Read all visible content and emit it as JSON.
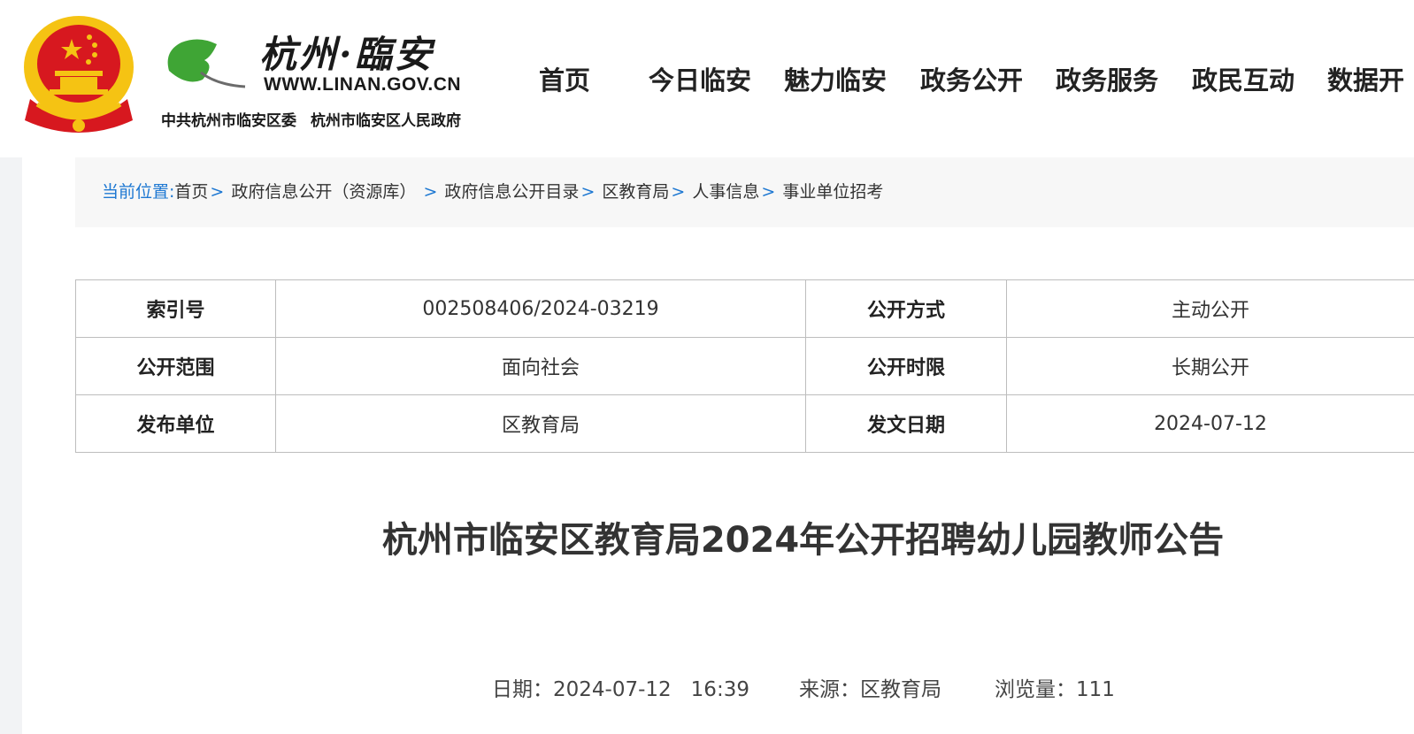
{
  "header": {
    "logo_calligraphy": "杭州·臨安",
    "site_url": "WWW.LINAN.GOV.CN",
    "org_party": "中共杭州市临安区委",
    "org_government": "杭州市临安区人民政府",
    "emblem_icon": "national-emblem-icon",
    "logo_icon": "ginkgo-leaf-icon"
  },
  "nav": {
    "items": [
      {
        "label": "首页"
      },
      {
        "label": "今日临安"
      },
      {
        "label": "魅力临安"
      },
      {
        "label": "政务公开"
      },
      {
        "label": "政务服务"
      },
      {
        "label": "政民互动"
      },
      {
        "label": "数据开"
      }
    ]
  },
  "breadcrumb": {
    "label": "当前位置:",
    "separator": ">",
    "items": [
      {
        "label": "首页"
      },
      {
        "label": "政府信息公开（资源库）"
      },
      {
        "label": "政府信息公开目录"
      },
      {
        "label": "区教育局"
      },
      {
        "label": "人事信息"
      },
      {
        "label": "事业单位招考"
      }
    ]
  },
  "meta": {
    "rows": [
      {
        "k1": "索引号",
        "v1": "002508406/2024-03219",
        "k2": "公开方式",
        "v2": "主动公开"
      },
      {
        "k1": "公开范围",
        "v1": "面向社会",
        "k2": "公开时限",
        "v2": "长期公开"
      },
      {
        "k1": "发布单位",
        "v1": "区教育局",
        "k2": "发文日期",
        "v2": "2024-07-12"
      }
    ]
  },
  "article": {
    "title": "杭州市临安区教育局2024年公开招聘幼儿园教师公告",
    "date_label": "日期：",
    "date": "2024-07-12",
    "time": "16:39",
    "source_label": "来源：",
    "source": "区教育局",
    "views_label": "浏览量：",
    "views": "111"
  },
  "colors": {
    "accent_blue": "#1e78d2",
    "emblem_red": "#d7181f",
    "emblem_gold": "#f5c313",
    "ginkgo_green": "#3fa535"
  }
}
